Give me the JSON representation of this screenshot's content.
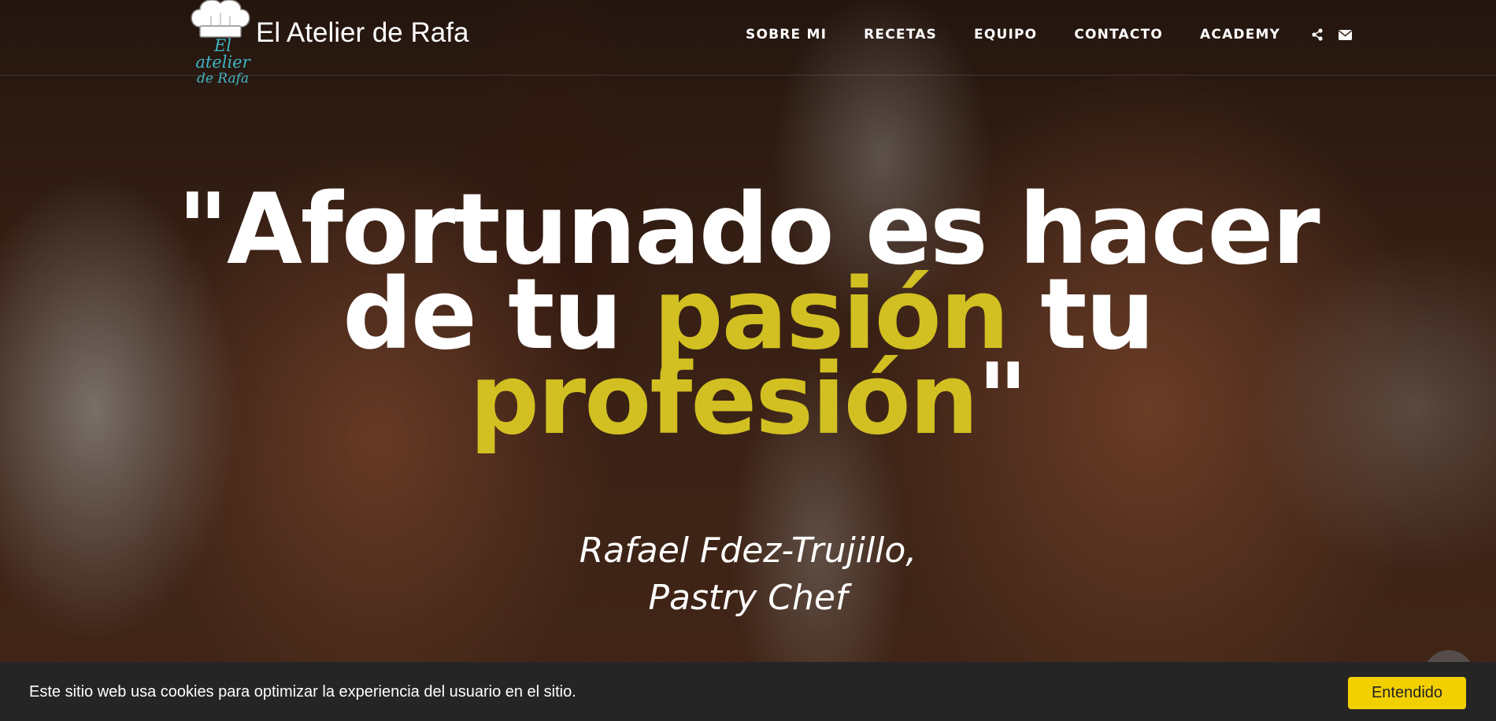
{
  "brand": {
    "title": "El Atelier de Rafa",
    "logo_script_line1": "El atelier",
    "logo_script_line2": "de Rafa",
    "logo_icon": "chef-hat-icon"
  },
  "nav": {
    "items": [
      {
        "label": "SOBRE MI"
      },
      {
        "label": "RECETAS"
      },
      {
        "label": "EQUIPO"
      },
      {
        "label": "CONTACTO"
      },
      {
        "label": "ACADEMY"
      }
    ],
    "icons": [
      "share-icon",
      "envelope-icon"
    ]
  },
  "hero": {
    "quote_line1": "\"Afortunado es hacer",
    "quote_line2_a": "de tu ",
    "quote_line2_highlight": "pasión",
    "quote_line2_b": " tu",
    "quote_line3_highlight": "profesión",
    "quote_line3_b": "\"",
    "attribution_line1": "Rafael Fdez-Trujillo,",
    "attribution_line2": "Pastry Chef"
  },
  "cookie": {
    "text": "Este sitio web usa cookies para optimizar la experiencia del usuario en el sitio.",
    "button": "Entendido"
  },
  "colors": {
    "highlight": "#d2c022",
    "logo_script": "#3fb6c6",
    "cookie_bar": "#252525",
    "cookie_button": "#f2d000"
  }
}
